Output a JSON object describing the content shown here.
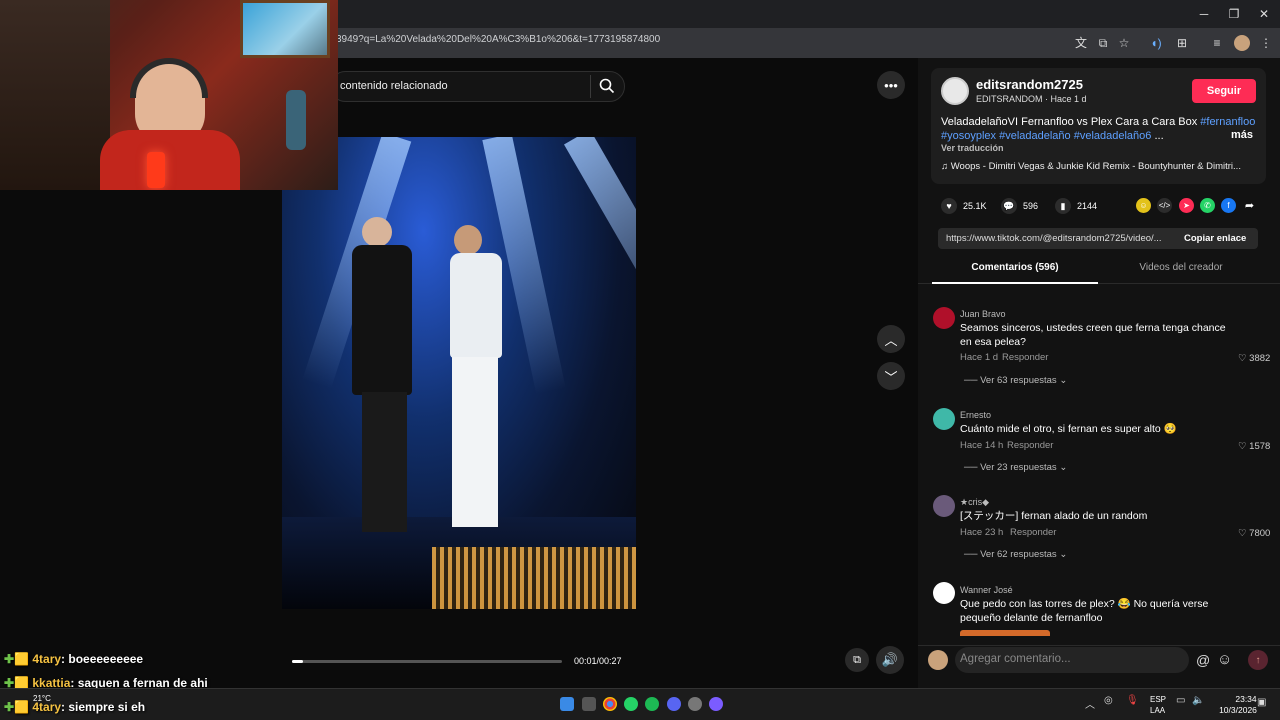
{
  "browser": {
    "url": "3949?q=La%20Velada%20Del%20A%C3%B1o%206&t=1773195874800",
    "window_controls": [
      "minimize",
      "restore",
      "close"
    ]
  },
  "search": {
    "placeholder": "contenido relacionado"
  },
  "player": {
    "time": "00:01/00:27",
    "progress": 0.04
  },
  "post": {
    "username": "editsrandom2725",
    "meta": "EDITSRANDOM · Hace 1 d",
    "follow_label": "Seguir",
    "desc_plain": "VeladadelañoVI Fernanfloo vs Plex Cara a Cara Box ",
    "desc_tag1": "#fernanfloo",
    "desc_tag2": "#yosoyplex #veladadelaño #veladadelaño6",
    "desc_ellipsis": " ...",
    "more": "más",
    "translate": "Ver traducción",
    "music": "Woops - Dimitri Vegas & Junkie Kid Remix - Bountyhunter & Dimitri...",
    "likes": "25.1K",
    "comments": "596",
    "saves": "2144",
    "link": "https://www.tiktok.com/@editsrandom2725/video/...",
    "copy_link": "Copiar enlace"
  },
  "tabs": {
    "comments": "Comentarios (596)",
    "videos": "Videos del creador"
  },
  "comments": [
    {
      "name": "Juan Bravo",
      "text": "Seamos sinceros, ustedes creen que ferna tenga chance en esa pelea?",
      "time": "Hace 1 d",
      "reply": "Responder",
      "likes": "3882",
      "replies": "Ver 63 respuestas",
      "color": "#b0102a"
    },
    {
      "name": "Ernesto",
      "text": "Cuánto mide el otro, si fernan es super alto 🥺",
      "time": "Hace 14 h",
      "reply": "Responder",
      "likes": "1578",
      "replies": "Ver 23 respuestas",
      "color": "#3fb8a8"
    },
    {
      "name": "★cris◆",
      "text": "[ステッカー] fernan alado de un random",
      "time": "Hace 23 h",
      "reply": "Responder",
      "likes": "7800",
      "replies": "Ver 62 respuestas",
      "color": "#6a5a7a"
    },
    {
      "name": "Wanner José",
      "text": "Que pedo con las torres de plex? 😂 No quería verse pequeño delante de fernanfloo",
      "color": "#ffffff"
    }
  ],
  "comment_input": {
    "placeholder": "Agregar comentario..."
  },
  "chat": [
    {
      "name": "4tary",
      "msg": ": boeeeeeeeee"
    },
    {
      "name": "kkattia",
      "msg": ": saquen a fernan de ahi"
    },
    {
      "name": "4tary",
      "msg": ": siempre si eh"
    }
  ],
  "taskbar": {
    "weather": "21°C",
    "lang1": "ESP",
    "lang2": "LAA",
    "time": "23:34",
    "date": "10/3/2026"
  }
}
